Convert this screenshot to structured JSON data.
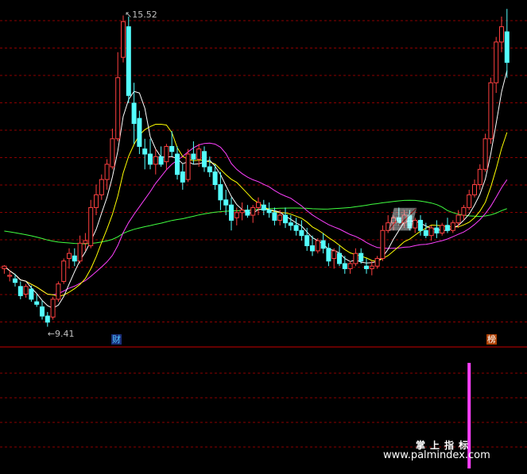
{
  "chart_data": {
    "type": "candlestick",
    "price_high_label": "15.52",
    "price_low_label": "9.41",
    "marker_left": "财",
    "marker_right": "榜",
    "ylim": [
      9.2,
      15.7
    ],
    "colors": {
      "up": "#ff4040",
      "down": "#54ffff",
      "ma5": "#ffffff",
      "ma10": "#ffff00",
      "ma20": "#ff40ff",
      "ma60": "#40ff40",
      "volume_bar": "#ff40ff",
      "grid": "#8b0000",
      "separator": "#c80000"
    },
    "candles": [
      [
        10.55,
        10.62,
        10.45,
        10.6
      ],
      [
        10.4,
        10.52,
        10.3,
        10.42
      ],
      [
        10.35,
        10.45,
        10.2,
        10.28
      ],
      [
        10.2,
        10.3,
        9.95,
        10.02
      ],
      [
        10.05,
        10.25,
        9.98,
        10.2
      ],
      [
        10.15,
        10.22,
        9.9,
        9.95
      ],
      [
        9.9,
        10.05,
        9.8,
        9.85
      ],
      [
        9.8,
        9.92,
        9.55,
        9.62
      ],
      [
        9.62,
        9.7,
        9.41,
        9.5
      ],
      [
        9.6,
        10.0,
        9.55,
        9.95
      ],
      [
        9.95,
        10.3,
        9.9,
        10.25
      ],
      [
        10.3,
        10.75,
        10.25,
        10.7
      ],
      [
        10.75,
        10.95,
        10.55,
        10.85
      ],
      [
        10.8,
        10.95,
        10.6,
        10.7
      ],
      [
        10.7,
        11.2,
        10.65,
        11.05
      ],
      [
        11.05,
        11.25,
        10.9,
        11.1
      ],
      [
        11.0,
        11.9,
        10.95,
        11.75
      ],
      [
        11.75,
        12.2,
        11.6,
        12.0
      ],
      [
        12.0,
        12.4,
        11.9,
        12.3
      ],
      [
        12.3,
        12.7,
        12.1,
        12.6
      ],
      [
        12.55,
        13.3,
        12.5,
        13.1
      ],
      [
        13.1,
        14.8,
        13.05,
        14.3
      ],
      [
        14.7,
        15.52,
        14.6,
        15.4
      ],
      [
        15.3,
        15.5,
        13.8,
        13.95
      ],
      [
        13.8,
        14.2,
        13.0,
        13.4
      ],
      [
        13.5,
        13.65,
        12.8,
        12.95
      ],
      [
        12.9,
        13.1,
        12.5,
        12.8
      ],
      [
        12.8,
        13.1,
        12.5,
        12.6
      ],
      [
        12.6,
        12.9,
        12.4,
        12.75
      ],
      [
        12.75,
        12.95,
        12.55,
        12.6
      ],
      [
        12.65,
        13.0,
        12.5,
        12.95
      ],
      [
        12.95,
        13.25,
        12.75,
        12.85
      ],
      [
        12.8,
        12.95,
        12.3,
        12.4
      ],
      [
        12.45,
        12.6,
        12.1,
        12.25
      ],
      [
        12.3,
        12.9,
        12.25,
        12.8
      ],
      [
        12.8,
        13.05,
        12.6,
        12.7
      ],
      [
        12.7,
        13.0,
        12.55,
        12.9
      ],
      [
        12.85,
        12.95,
        12.45,
        12.55
      ],
      [
        12.55,
        12.75,
        12.35,
        12.45
      ],
      [
        12.45,
        12.6,
        12.1,
        12.2
      ],
      [
        12.2,
        12.45,
        11.7,
        11.9
      ],
      [
        11.9,
        12.1,
        11.6,
        11.8
      ],
      [
        11.8,
        11.95,
        11.3,
        11.5
      ],
      [
        11.55,
        11.75,
        11.4,
        11.65
      ],
      [
        11.65,
        11.85,
        11.5,
        11.7
      ],
      [
        11.7,
        11.8,
        11.55,
        11.6
      ],
      [
        11.6,
        11.8,
        11.45,
        11.75
      ],
      [
        11.75,
        11.95,
        11.6,
        11.85
      ],
      [
        11.8,
        11.9,
        11.6,
        11.7
      ],
      [
        11.7,
        11.85,
        11.55,
        11.65
      ],
      [
        11.65,
        11.75,
        11.4,
        11.5
      ],
      [
        11.5,
        11.7,
        11.4,
        11.6
      ],
      [
        11.6,
        11.75,
        11.35,
        11.45
      ],
      [
        11.45,
        11.6,
        11.3,
        11.4
      ],
      [
        11.4,
        11.55,
        11.2,
        11.3
      ],
      [
        11.3,
        11.5,
        11.1,
        11.2
      ],
      [
        11.2,
        11.35,
        10.9,
        11.0
      ],
      [
        11.0,
        11.2,
        10.8,
        10.9
      ],
      [
        10.9,
        11.15,
        10.85,
        11.1
      ],
      [
        11.1,
        11.25,
        10.85,
        10.95
      ],
      [
        10.95,
        11.05,
        10.6,
        10.7
      ],
      [
        10.75,
        10.95,
        10.55,
        10.9
      ],
      [
        10.85,
        11.0,
        10.6,
        10.65
      ],
      [
        10.65,
        10.8,
        10.45,
        10.55
      ],
      [
        10.55,
        10.7,
        10.45,
        10.65
      ],
      [
        10.65,
        10.95,
        10.6,
        10.85
      ],
      [
        10.85,
        10.95,
        10.65,
        10.7
      ],
      [
        10.6,
        10.75,
        10.45,
        10.55
      ],
      [
        10.55,
        10.7,
        10.42,
        10.6
      ],
      [
        10.6,
        10.8,
        10.55,
        10.75
      ],
      [
        10.75,
        11.4,
        10.7,
        11.3
      ],
      [
        11.3,
        11.6,
        11.25,
        11.45
      ],
      [
        11.45,
        11.6,
        11.3,
        11.55
      ],
      [
        11.55,
        11.75,
        11.4,
        11.45
      ],
      [
        11.45,
        11.7,
        11.35,
        11.6
      ],
      [
        11.6,
        11.7,
        11.3,
        11.35
      ],
      [
        11.35,
        11.55,
        11.25,
        11.5
      ],
      [
        11.5,
        11.6,
        11.2,
        11.3
      ],
      [
        11.3,
        11.45,
        11.15,
        11.2
      ],
      [
        11.2,
        11.4,
        11.1,
        11.35
      ],
      [
        11.35,
        11.5,
        11.15,
        11.25
      ],
      [
        11.25,
        11.45,
        11.2,
        11.4
      ],
      [
        11.4,
        11.55,
        11.25,
        11.3
      ],
      [
        11.3,
        11.5,
        11.25,
        11.45
      ],
      [
        11.45,
        11.7,
        11.35,
        11.6
      ],
      [
        11.6,
        11.8,
        11.5,
        11.75
      ],
      [
        11.75,
        12.1,
        11.7,
        12.0
      ],
      [
        12.0,
        12.3,
        11.95,
        12.2
      ],
      [
        12.2,
        12.6,
        12.1,
        12.5
      ],
      [
        12.5,
        13.2,
        12.45,
        13.1
      ],
      [
        13.1,
        14.3,
        13.0,
        14.2
      ],
      [
        14.2,
        15.1,
        14.0,
        15.0
      ],
      [
        15.0,
        15.5,
        14.8,
        15.3
      ],
      [
        15.2,
        15.65,
        14.3,
        14.6
      ]
    ],
    "volume": [
      {
        "index": 86,
        "value": 1.0
      }
    ]
  }
}
